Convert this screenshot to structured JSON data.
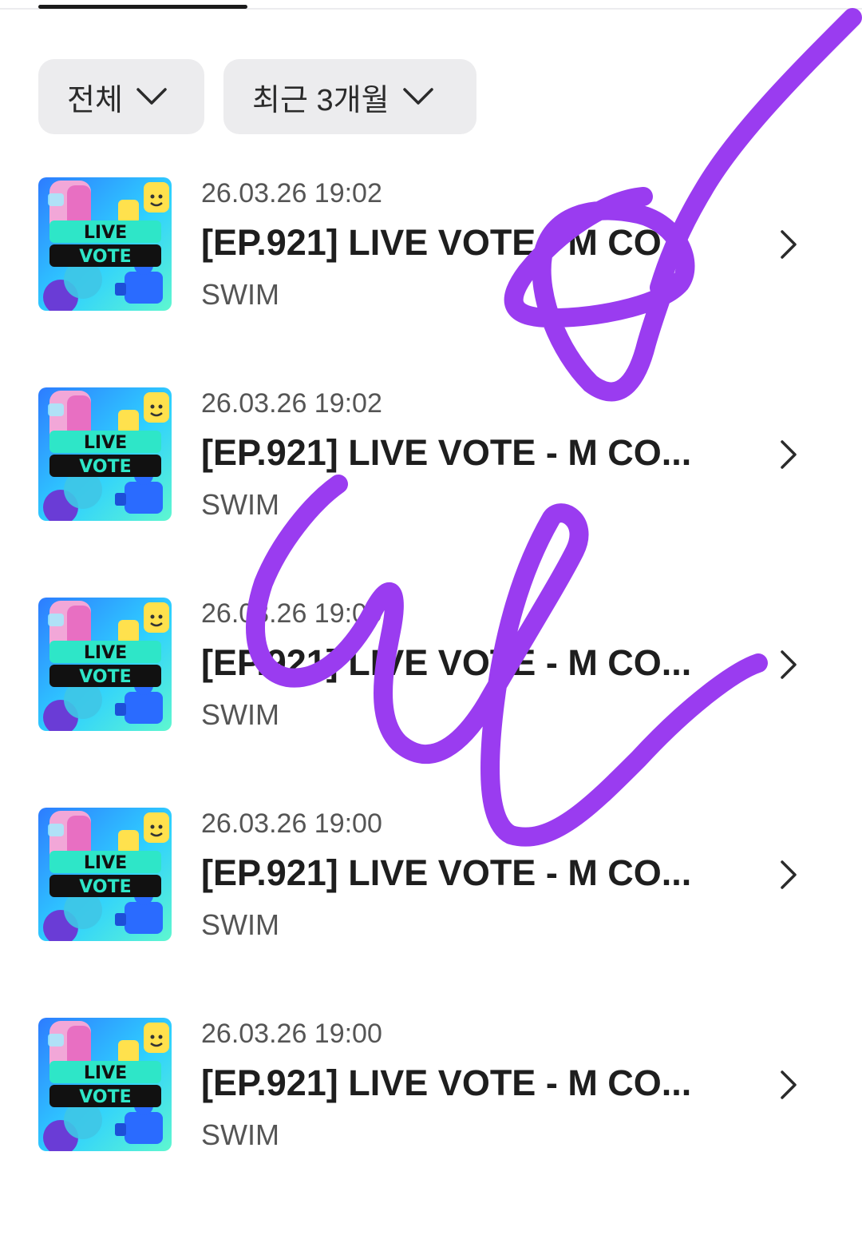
{
  "filters": {
    "category": {
      "label": "전체",
      "icon": "chevron-down-icon"
    },
    "period": {
      "label": "최근 3개월",
      "icon": "chevron-down-icon"
    }
  },
  "items": [
    {
      "date": "26.03.26 19:02",
      "title": "[EP.921] LIVE VOTE - M CO...",
      "artist": "SWIM",
      "thumb_text": [
        "LIVE",
        "VOTE"
      ]
    },
    {
      "date": "26.03.26 19:02",
      "title": "[EP.921] LIVE VOTE - M CO...",
      "artist": "SWIM",
      "thumb_text": [
        "LIVE",
        "VOTE"
      ]
    },
    {
      "date": "26.03.26 19:00",
      "title": "[EP.921] LIVE VOTE - M CO...",
      "artist": "SWIM",
      "thumb_text": [
        "LIVE",
        "VOTE"
      ]
    },
    {
      "date": "26.03.26 19:00",
      "title": "[EP.921] LIVE VOTE - M CO...",
      "artist": "SWIM",
      "thumb_text": [
        "LIVE",
        "VOTE"
      ]
    },
    {
      "date": "26.03.26 19:00",
      "title": "[EP.921] LIVE VOTE - M CO...",
      "artist": "SWIM",
      "thumb_text": [
        "LIVE",
        "VOTE"
      ]
    }
  ],
  "colors": {
    "scribble": "#9a3cf0",
    "filter_bg": "#ececee",
    "thumb_teal": "#2ee6c8",
    "thumb_blue": "#2a6bff"
  }
}
